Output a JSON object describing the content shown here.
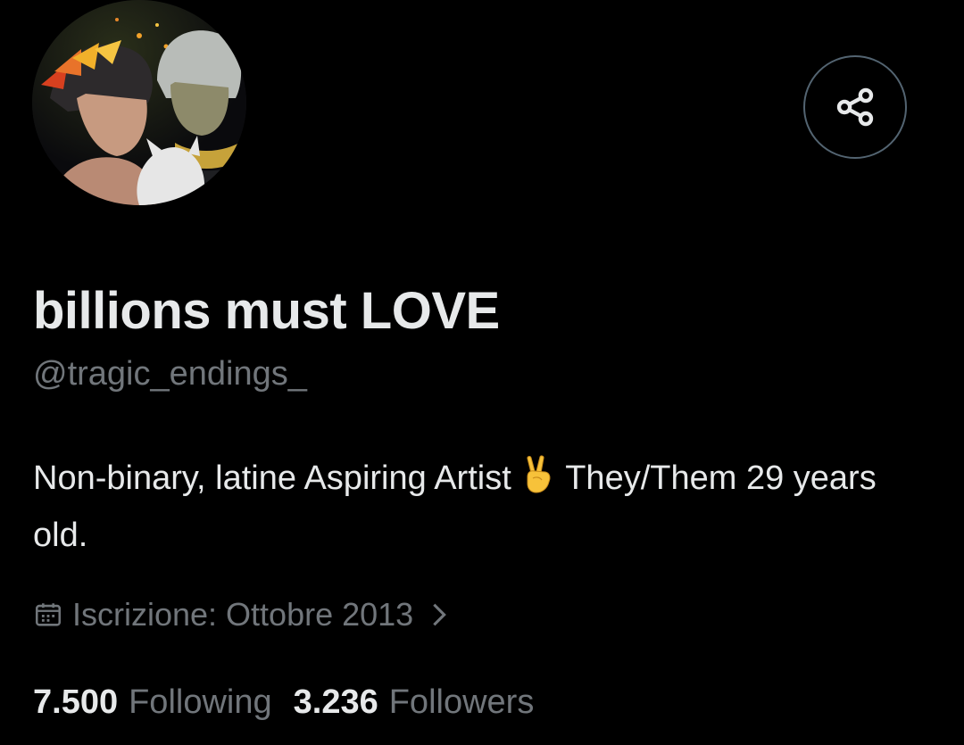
{
  "profile": {
    "display_name": "billions must LOVE",
    "handle": "@tragic_endings_",
    "bio_part1": "Non-binary, latine Aspiring Artist",
    "bio_emoji": "victory-hand-emoji",
    "bio_part2": "They/Them 29 years old.",
    "joined": "Iscrizione: Ottobre 2013",
    "avatar_icon": "profile-avatar"
  },
  "actions": {
    "share_icon": "share-icon"
  },
  "stats": {
    "following_count": "7.500",
    "following_label": "Following",
    "followers_count": "3.236",
    "followers_label": "Followers"
  },
  "colors": {
    "background": "#000000",
    "primary_text": "#e7e9ea",
    "secondary_text": "#71767b",
    "border": "#536471"
  }
}
